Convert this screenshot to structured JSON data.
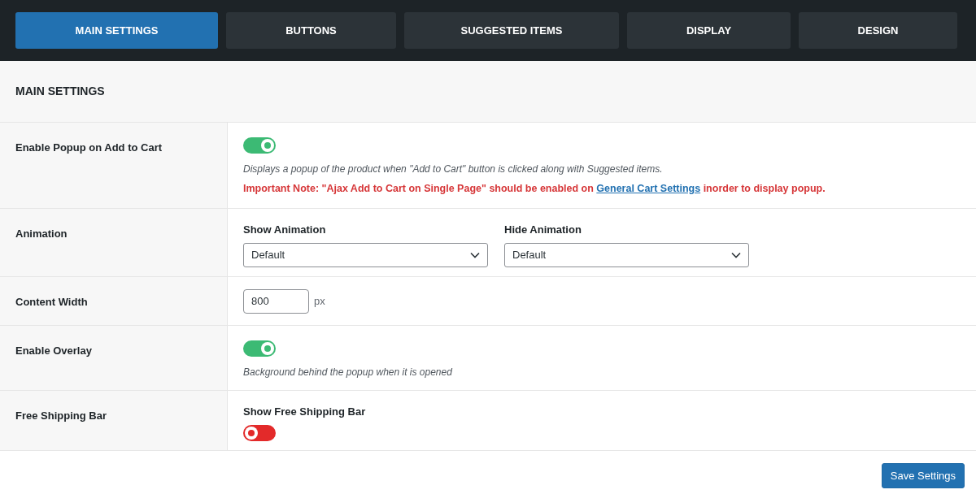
{
  "tabs": [
    {
      "label": "MAIN SETTINGS",
      "selected": true
    },
    {
      "label": "BUTTONS",
      "selected": false
    },
    {
      "label": "SUGGESTED ITEMS",
      "selected": false
    },
    {
      "label": "DISPLAY",
      "selected": false
    },
    {
      "label": "DESIGN",
      "selected": false
    }
  ],
  "section_title": "MAIN SETTINGS",
  "rows": [
    {
      "kind": "toggle",
      "label": "Enable Popup on Add to Cart",
      "on": true,
      "description": "Displays a popup of the product when \"Add to Cart\" button is clicked along with Suggested items.",
      "note": {
        "before": "Important Note: \"Ajax Add to Cart on Single Page\" should be enabled on",
        "link": "General Cart Settings",
        "after": "inorder to display popup."
      }
    },
    {
      "kind": "selects",
      "label": "Animation",
      "selects": [
        {
          "label": "Show Animation",
          "value": "Default"
        },
        {
          "label": "Hide Animation",
          "value": "Default"
        }
      ]
    },
    {
      "kind": "number",
      "label": "Content Width",
      "value": "800",
      "unit": "px"
    },
    {
      "kind": "toggle",
      "label": "Enable Overlay",
      "on": true,
      "description": "Background behind the popup when it is opened"
    },
    {
      "kind": "labeled-toggle",
      "label": "Free Shipping Bar",
      "toggle_label": "Show Free Shipping Bar",
      "on": false
    }
  ],
  "save_button": "Save Settings"
}
